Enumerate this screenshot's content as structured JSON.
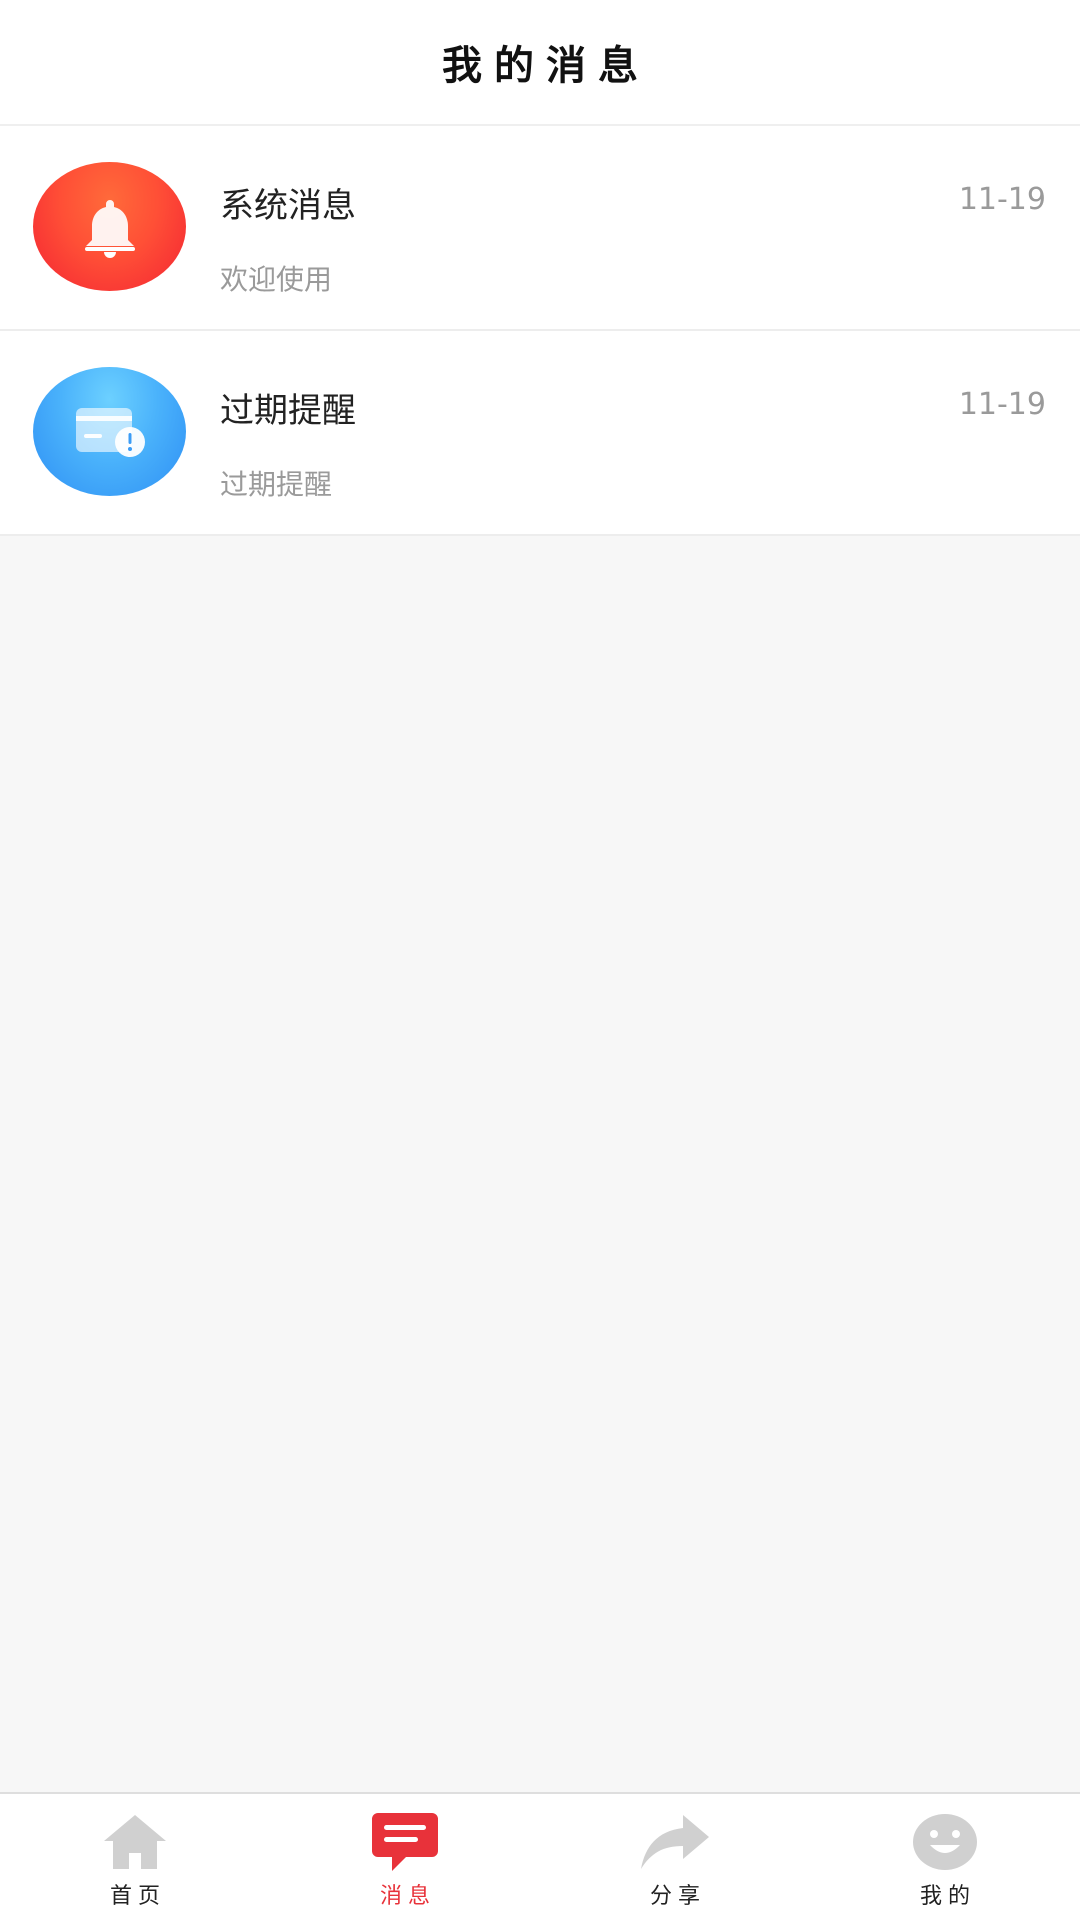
{
  "header": {
    "title": "我的消息"
  },
  "messages": [
    {
      "title": "系统消息",
      "date": "11-19",
      "desc": "欢迎使用",
      "icon": "bell-icon",
      "color": "#f5493a"
    },
    {
      "title": "过期提醒",
      "date": "11-19",
      "desc": "过期提醒",
      "icon": "card-alert-icon",
      "color": "#3fa3f8"
    }
  ],
  "tabbar": {
    "active_color": "#e8323a",
    "inactive_icon_color": "#d0d0d0",
    "items": [
      {
        "label": "首页",
        "icon": "home-icon",
        "active": false
      },
      {
        "label": "消息",
        "icon": "message-icon",
        "active": true
      },
      {
        "label": "分享",
        "icon": "share-icon",
        "active": false
      },
      {
        "label": "我的",
        "icon": "smile-icon",
        "active": false
      }
    ]
  }
}
